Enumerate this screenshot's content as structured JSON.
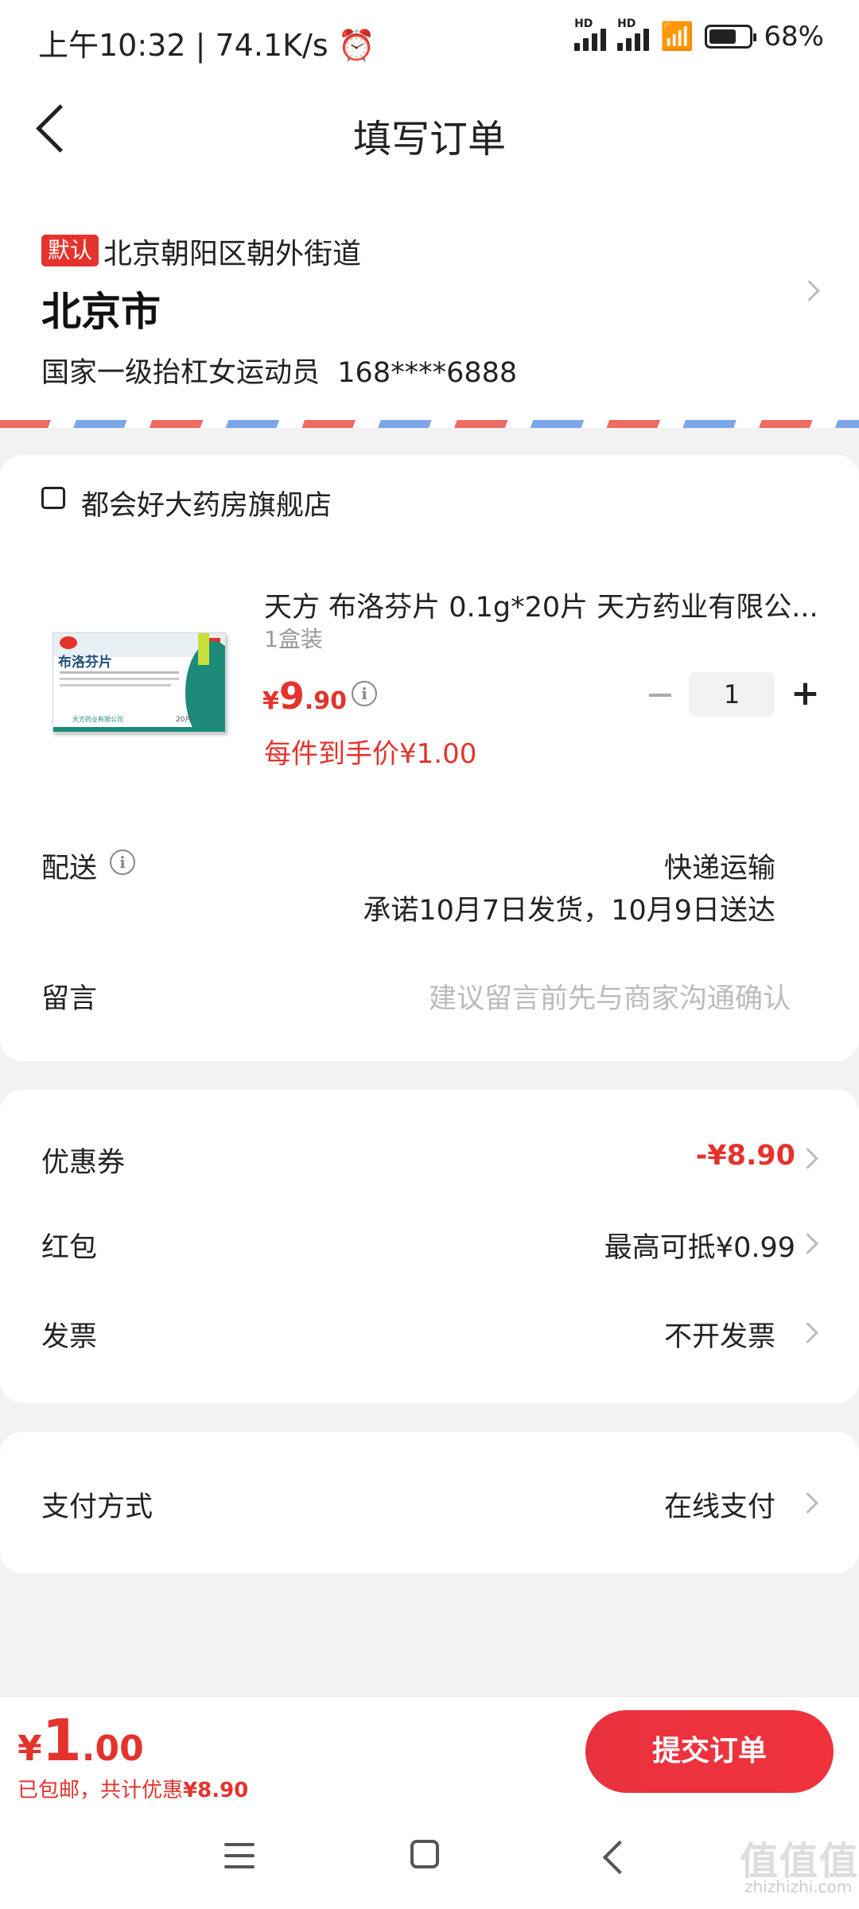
{
  "status_bar": {
    "time": "上午10:32",
    "net_speed": "74.1K/s",
    "battery_text": "68%",
    "battery_level": 0.68
  },
  "header": {
    "title": "填写订单"
  },
  "address": {
    "default_tag": "默认",
    "line1": "北京朝阳区朝外街道",
    "city": "北京市",
    "name": "国家一级抬杠女运动员",
    "phone": "168****6888"
  },
  "store": {
    "name": "都会好大药房旗舰店"
  },
  "product": {
    "title": "天方 布洛芬片 0.1g*20片 天方药业有限公...",
    "spec": "1盒装",
    "price_symbol": "¥",
    "price_int": "9",
    "price_dec": ".90",
    "quantity": "1",
    "unit_price": "每件到手价¥1.00",
    "box_name": "布洛芬片",
    "box_maker": "天方药业有限公司",
    "box_count": "20片"
  },
  "delivery": {
    "label": "配送",
    "method": "快递运输",
    "promise": "承诺10月7日发货，10月9日送达"
  },
  "message": {
    "label": "留言",
    "placeholder": "建议留言前先与商家沟通确认"
  },
  "discounts": {
    "coupon_label": "优惠券",
    "coupon_value": "-¥8.90",
    "redpacket_label": "红包",
    "redpacket_value": "最高可抵¥0.99",
    "invoice_label": "发票",
    "invoice_value": "不开发票"
  },
  "payment": {
    "label": "支付方式",
    "value": "在线支付"
  },
  "footer": {
    "total_symbol": "¥",
    "total_int": "1",
    "total_dec": ".00",
    "shipping": "已包邮，共计优惠",
    "saved": "¥8.90",
    "submit_label": "提交订单"
  },
  "watermark": {
    "text": "值值值",
    "url": "zhizhizhi.com"
  },
  "colors": {
    "accent": "#e4332d",
    "background": "#f2f2f2"
  }
}
